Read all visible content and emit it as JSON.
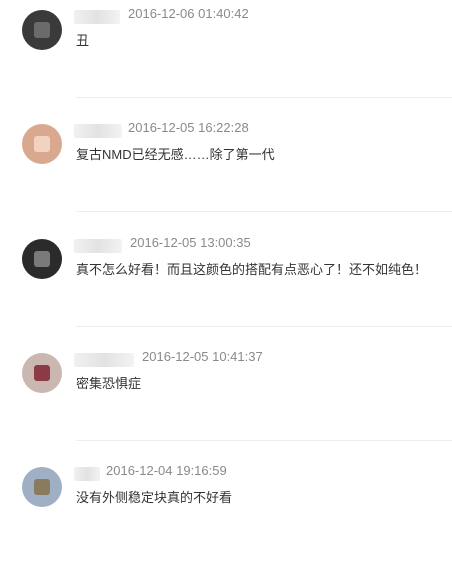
{
  "comments": [
    {
      "timestamp": "2016-12-06 01:40:42",
      "text": "丑",
      "avatar_color": "#3a3a3a",
      "avatar_accent": "#6b6b6b"
    },
    {
      "timestamp": "2016-12-05 16:22:28",
      "text": "复古NMD已经无感……除了第一代",
      "avatar_color": "#d9a98f",
      "avatar_accent": "#f2d2c0"
    },
    {
      "timestamp": "2016-12-05 13:00:35",
      "text": "真不怎么好看！而且这颜色的搭配有点恶心了！还不如纯色！",
      "avatar_color": "#2b2b2b",
      "avatar_accent": "#7a7a7a"
    },
    {
      "timestamp": "2016-12-05 10:41:37",
      "text": "密集恐惧症",
      "avatar_color": "#c9b7b0",
      "avatar_accent": "#8b3a46"
    },
    {
      "timestamp": "2016-12-04 19:16:59",
      "text": "没有外侧稳定块真的不好看",
      "avatar_color": "#9fb0c4",
      "avatar_accent": "#8a7a5e"
    }
  ]
}
